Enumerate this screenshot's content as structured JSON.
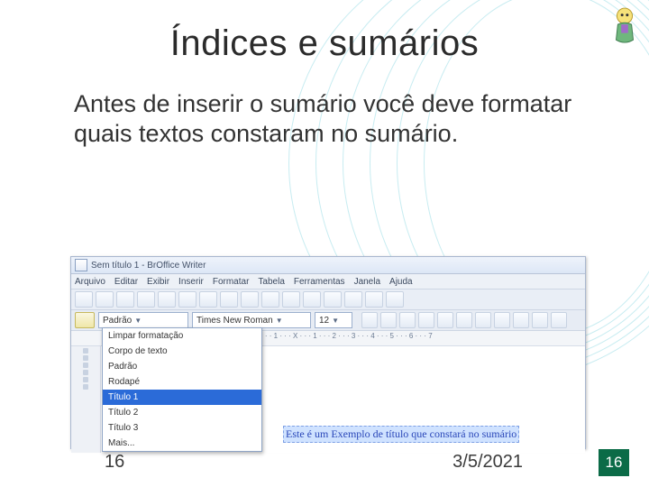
{
  "slide": {
    "title": "Índices e sumários",
    "body": "Antes de inserir o sumário você deve formatar quais textos constaram no sumário.",
    "footer_left": "16",
    "footer_date": "3/5/2021",
    "footer_badge": "16"
  },
  "app": {
    "titlebar": "Sem título 1 - BrOffice Writer",
    "menus": [
      "Arquivo",
      "Editar",
      "Exibir",
      "Inserir",
      "Formatar",
      "Tabela",
      "Ferramentas",
      "Janela",
      "Ajuda"
    ],
    "style_combo_value": "Padrão",
    "font_combo_value": "Times New Roman",
    "size_combo_value": "12",
    "ruler_text": "· · · 1 · · · X · · · 1 · · · 2 · · · 3 · · · 4 · · · 5 · · · 6 · · · 7",
    "style_options": [
      "Limpar formatação",
      "Corpo de texto",
      "Padrão",
      "Rodapé",
      "Título 1",
      "Título 2",
      "Título 3",
      "Mais..."
    ],
    "style_selected_index": 4,
    "document_text": "Este é um Exemplo de título que constará no sumário"
  },
  "colors": {
    "badge_bg": "#0b6b47",
    "selection_bg": "#2b6bd8"
  }
}
